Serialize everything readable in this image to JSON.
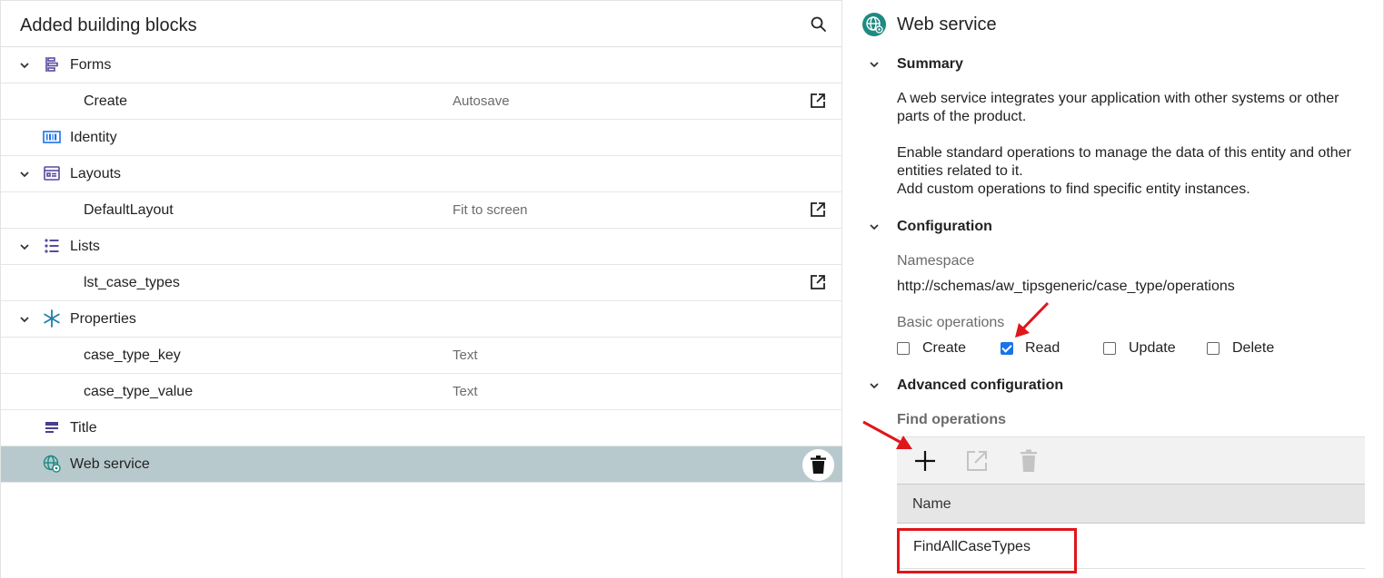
{
  "left_panel": {
    "title": "Added building blocks",
    "rows": [
      {
        "label": "Forms",
        "sub": "",
        "type": "group"
      },
      {
        "label": "Create",
        "sub": "Autosave",
        "type": "child"
      },
      {
        "label": "Identity",
        "sub": "",
        "type": "item"
      },
      {
        "label": "Layouts",
        "sub": "",
        "type": "group"
      },
      {
        "label": "DefaultLayout",
        "sub": "Fit to screen",
        "type": "child"
      },
      {
        "label": "Lists",
        "sub": "",
        "type": "group"
      },
      {
        "label": "lst_case_types",
        "sub": "",
        "type": "child"
      },
      {
        "label": "Properties",
        "sub": "",
        "type": "group"
      },
      {
        "label": "case_type_key",
        "sub": "Text",
        "type": "child"
      },
      {
        "label": "case_type_value",
        "sub": "Text",
        "type": "child"
      },
      {
        "label": "Title",
        "sub": "",
        "type": "item"
      },
      {
        "label": "Web service",
        "sub": "",
        "type": "item",
        "selected": true
      }
    ]
  },
  "right_panel": {
    "title": "Web service",
    "summary": {
      "title": "Summary",
      "para1": "A web service integrates your application with other systems or other parts of the product.",
      "para2a": "Enable standard operations to manage the data of this entity and other entities related to it.",
      "para2b": "Add custom operations to find specific entity instances."
    },
    "configuration": {
      "title": "Configuration",
      "namespace_label": "Namespace",
      "namespace_value": "http://schemas/aw_tipsgeneric/case_type/operations",
      "basic_ops_label": "Basic operations",
      "ops": [
        {
          "label": "Create",
          "checked": false
        },
        {
          "label": "Read",
          "checked": true
        },
        {
          "label": "Update",
          "checked": false
        },
        {
          "label": "Delete",
          "checked": false
        }
      ]
    },
    "advanced": {
      "title": "Advanced configuration",
      "find_label": "Find operations",
      "column_name": "Name",
      "rows": [
        "FindAllCaseTypes"
      ]
    }
  },
  "colors": {
    "selected_row": "#b8c9ce",
    "accent_purple": "#5b4a9e",
    "checkbox_blue": "#1a73e8",
    "annotation_red": "#e0161b",
    "teal_icon": "#1f8a82"
  }
}
